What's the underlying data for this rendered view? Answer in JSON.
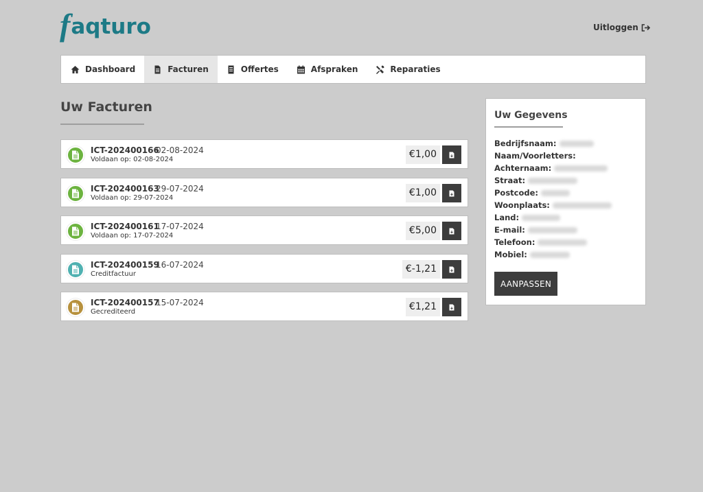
{
  "brand": {
    "logo_f": "f",
    "logo_rest": "aqturo",
    "color": "#1d7a86"
  },
  "header": {
    "logout_label": "Uitloggen"
  },
  "nav": {
    "items": [
      {
        "label": "Dashboard",
        "icon": "home-icon",
        "active": false
      },
      {
        "label": "Facturen",
        "icon": "invoice-icon",
        "active": true
      },
      {
        "label": "Offertes",
        "icon": "book-icon",
        "active": false
      },
      {
        "label": "Afspraken",
        "icon": "calendar-icon",
        "active": false
      },
      {
        "label": "Reparaties",
        "icon": "wrench-icon",
        "active": false
      }
    ]
  },
  "main": {
    "title": "Uw Facturen",
    "invoices": [
      {
        "number": "ICT-202400166",
        "date": "02-08-2024",
        "status": "Voldaan op: 02-08-2024",
        "amount": "€1,00",
        "status_color": "#6cb33f"
      },
      {
        "number": "ICT-202400163",
        "date": "29-07-2024",
        "status": "Voldaan op: 29-07-2024",
        "amount": "€1,00",
        "status_color": "#6cb33f"
      },
      {
        "number": "ICT-202400161",
        "date": "17-07-2024",
        "status": "Voldaan op: 17-07-2024",
        "amount": "€5,00",
        "status_color": "#6cb33f"
      },
      {
        "number": "ICT-202400159",
        "date": "16-07-2024",
        "status": "Creditfactuur",
        "amount": "€-1,21",
        "status_color": "#4fb1b1"
      },
      {
        "number": "ICT-202400157",
        "date": "15-07-2024",
        "status": "Gecrediteerd",
        "amount": "€1,21",
        "status_color": "#b7913d"
      }
    ]
  },
  "sidebar": {
    "title": "Uw Gegevens",
    "fields": [
      {
        "label": "Bedrijfsnaam:"
      },
      {
        "label": "Naam/Voorletters:"
      },
      {
        "label": "Achternaam:"
      },
      {
        "label": "Straat:"
      },
      {
        "label": "Postcode:"
      },
      {
        "label": "Woonplaats:"
      },
      {
        "label": "Land:"
      },
      {
        "label": "E-mail:"
      },
      {
        "label": "Telefoon:"
      },
      {
        "label": "Mobiel:"
      }
    ],
    "edit_label": "AANPASSEN"
  }
}
